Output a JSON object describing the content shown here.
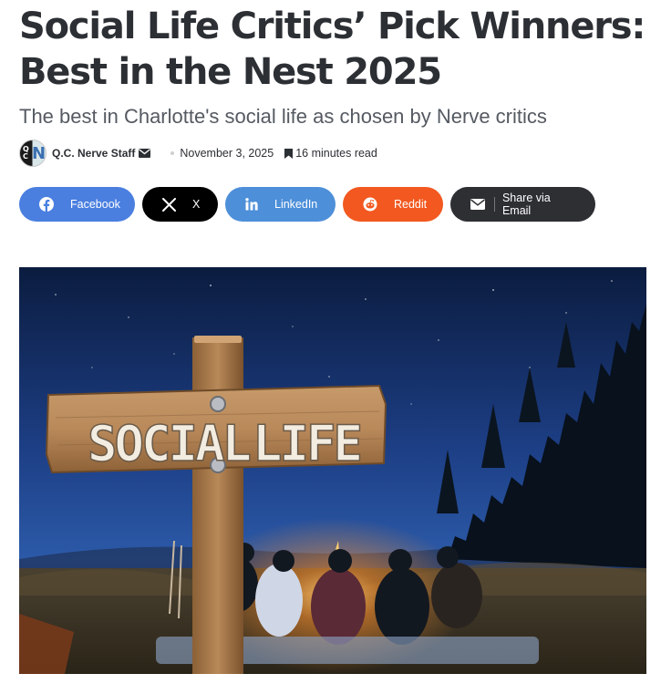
{
  "article": {
    "title": "Social Life Critics’ Pick Winners: Best in the Nest 2025",
    "subtitle": "The best in Charlotte's social life as chosen by Nerve critics"
  },
  "meta": {
    "author": "Q.C. Nerve Staff",
    "date": "November 3, 2025",
    "read_time": "16 minutes read",
    "icons": [
      "mail-icon",
      "bookmark-icon"
    ]
  },
  "share": {
    "facebook": "Facebook",
    "x": "X",
    "linkedin": "LinkedIn",
    "reddit": "Reddit",
    "email": "Share via Email",
    "colors": {
      "facebook": "#4a7fe0",
      "x": "#000000",
      "linkedin": "#4d8fd9",
      "reddit": "#f2581f",
      "email": "#2d2f33"
    }
  },
  "hero": {
    "sign_text": [
      "SOCIAL",
      "LIFE"
    ]
  }
}
